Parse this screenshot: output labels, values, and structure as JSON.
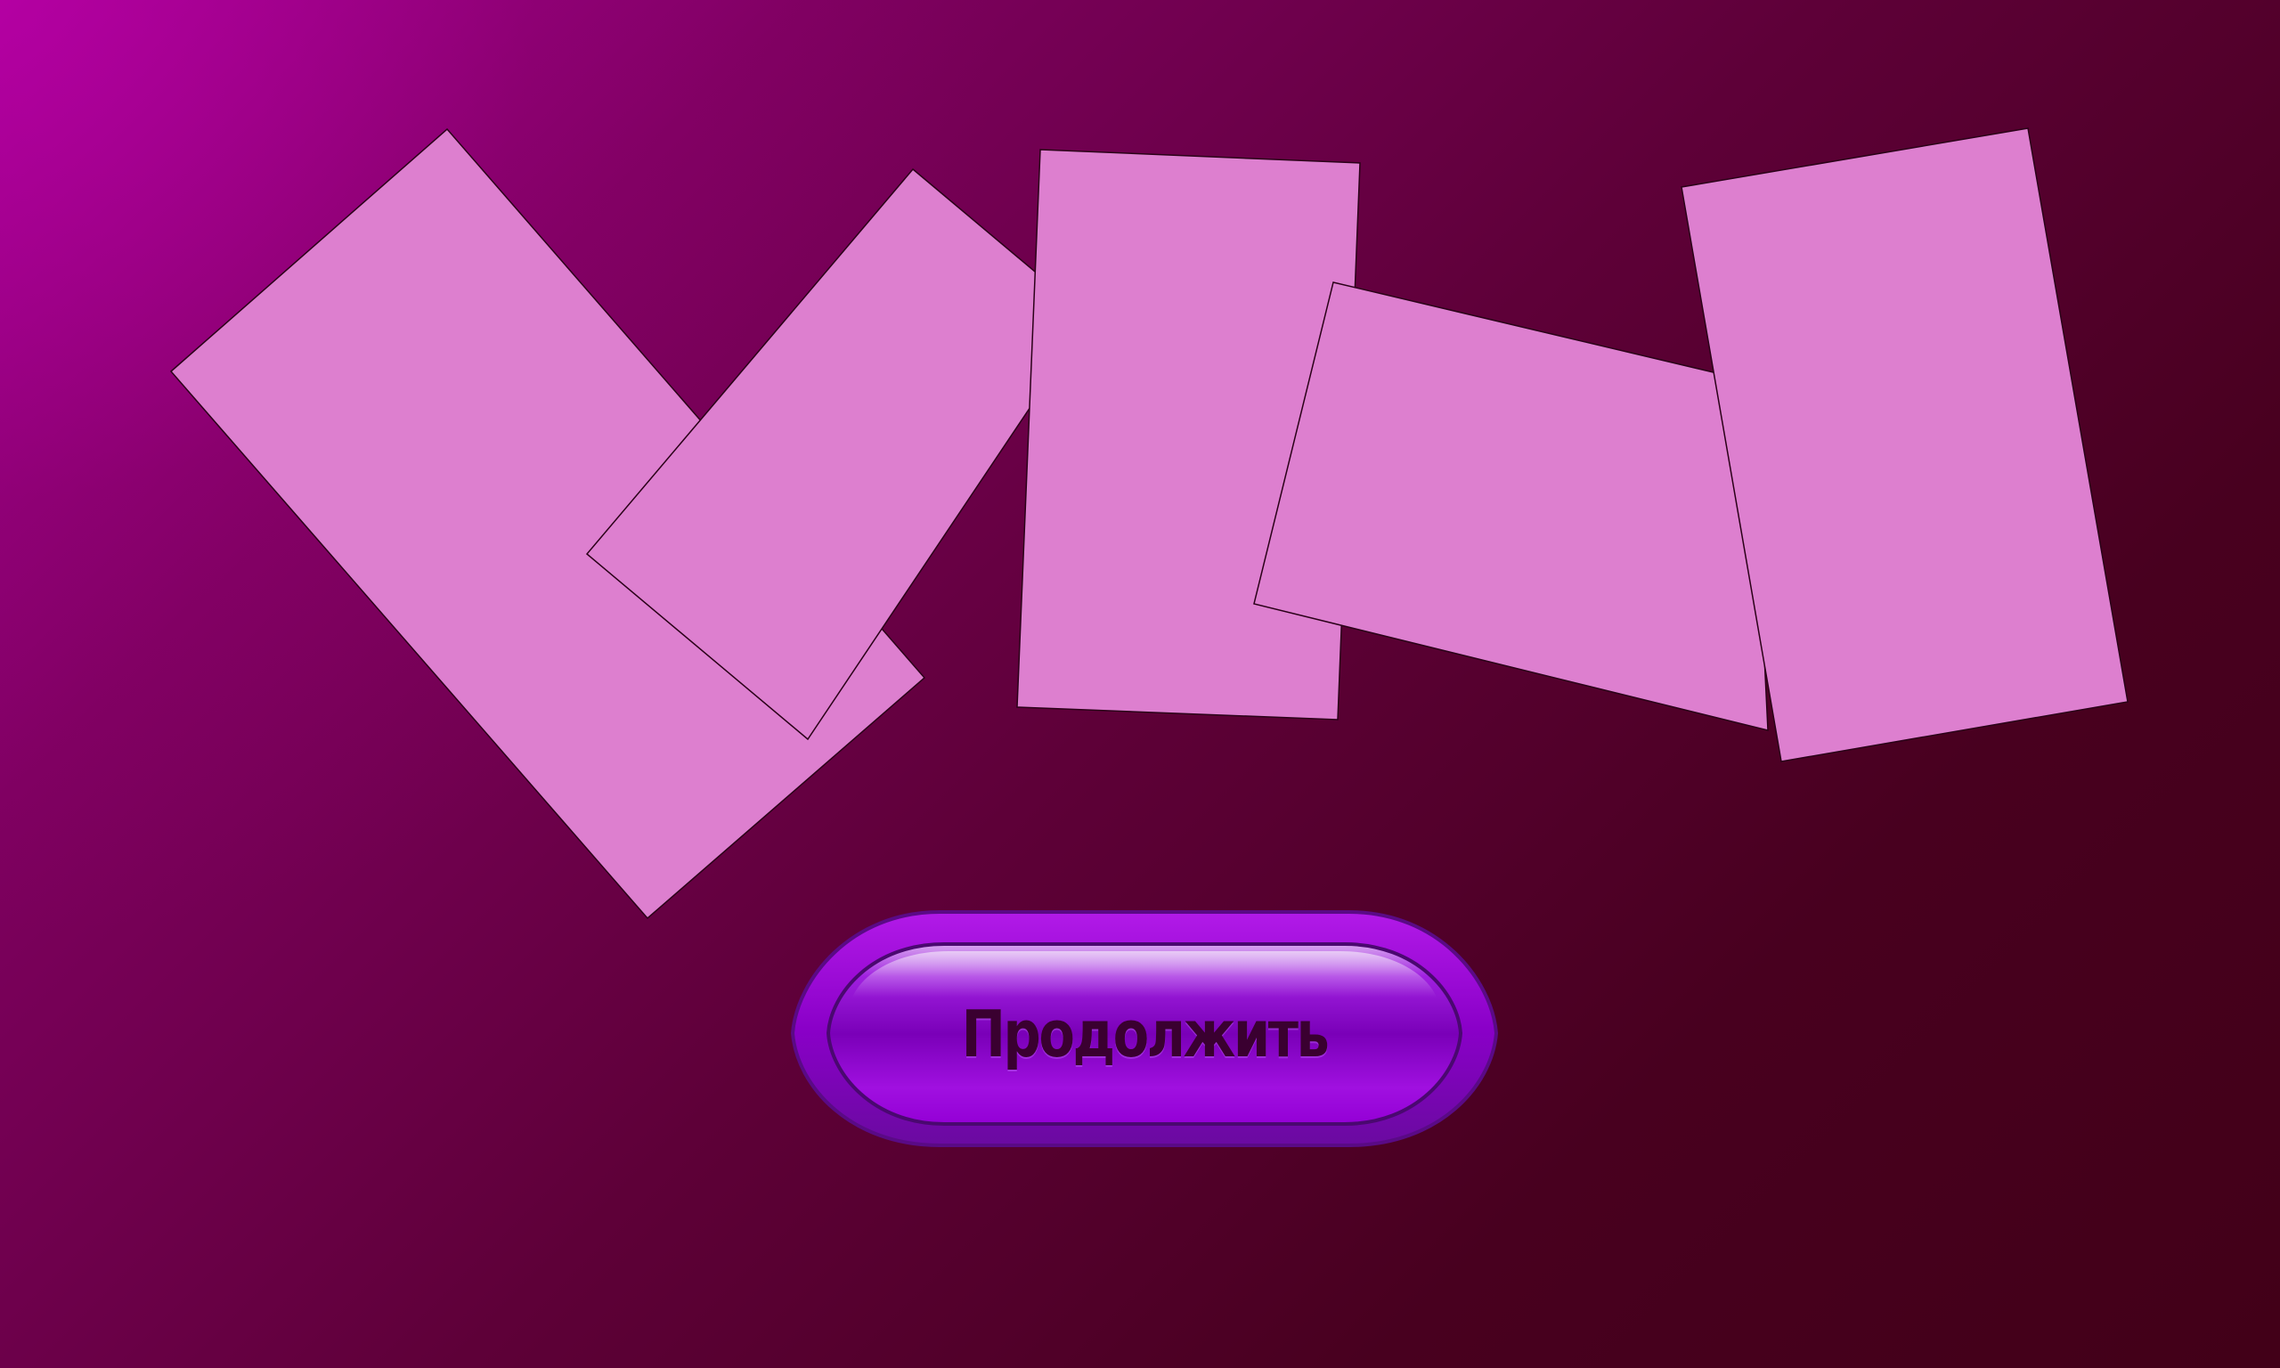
{
  "screen": {
    "background": {
      "top_left": "#a8009a",
      "bottom_right": "#420018"
    },
    "cards": [
      {
        "id": "card-1",
        "color": "#dd7fcf"
      },
      {
        "id": "card-2",
        "color": "#dd7fcf"
      },
      {
        "id": "card-3",
        "color": "#dd7fcf"
      },
      {
        "id": "card-4",
        "color": "#dd7fcf"
      },
      {
        "id": "card-5",
        "color": "#dd7fcf"
      }
    ],
    "continue_button": {
      "label": "Продолжить",
      "color": "#9a00d8",
      "text_color": "#3a0030"
    }
  }
}
